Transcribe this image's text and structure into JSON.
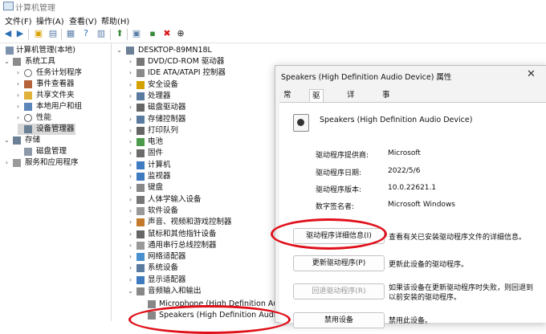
{
  "window": {
    "title": "计算机管理"
  },
  "menu": [
    "文件(F)",
    "操作(A)",
    "查看(V)",
    "帮助(H)"
  ],
  "toolbar": {
    "icons": [
      "back-arrow-icon",
      "forward-arrow-icon",
      "folder-up-icon",
      "console-tree-icon",
      "properties-icon",
      "help-icon",
      "show-pane-icon",
      "update-driver-icon",
      "enable-icon",
      "delete-icon",
      "download-icon"
    ]
  },
  "left_tree": [
    {
      "label": "计算机管理(本地)",
      "icon": "computer-mgmt-icon"
    },
    {
      "label": "系统工具",
      "icon": "tools-icon"
    },
    {
      "label": "任务计划程序",
      "icon": "clock-icon"
    },
    {
      "label": "事件查看器",
      "icon": "event-viewer-icon"
    },
    {
      "label": "共享文件夹",
      "icon": "shared-folder-icon"
    },
    {
      "label": "本地用户和组",
      "icon": "users-icon"
    },
    {
      "label": "性能",
      "icon": "performance-icon"
    },
    {
      "label": "设备管理器",
      "icon": "device-manager-icon"
    },
    {
      "label": "存储",
      "icon": "storage-icon"
    },
    {
      "label": "磁盘管理",
      "icon": "disk-icon"
    },
    {
      "label": "服务和应用程序",
      "icon": "services-icon"
    }
  ],
  "device_tree": {
    "root": "DESKTOP-89MN18L",
    "categories": [
      "DVD/CD-ROM 驱动器",
      "IDE ATA/ATAPI 控制器",
      "安全设备",
      "处理器",
      "磁盘驱动器",
      "存储控制器",
      "打印队列",
      "电池",
      "固件",
      "计算机",
      "监视器",
      "键盘",
      "人体学输入设备",
      "软件设备",
      "声音、视频和游戏控制器",
      "鼠标和其他指针设备",
      "通用串行总线控制器",
      "网络适配器",
      "系统设备",
      "显示适配器",
      "音频输入和输出"
    ],
    "audio_children": [
      "Microphone (High Definition Audio",
      "Speakers (High Definition Audio De"
    ]
  },
  "dialog": {
    "title": "Speakers (High Definition Audio Device) 属性",
    "tabs": [
      "常规",
      "驱动程序",
      "详细信息",
      "事件"
    ],
    "device_name": "Speakers (High Definition Audio Device)",
    "props": [
      {
        "label": "驱动程序提供商:",
        "value": "Microsoft"
      },
      {
        "label": "驱动程序日期:",
        "value": "2022/5/6"
      },
      {
        "label": "驱动程序版本:",
        "value": "10.0.22621.1"
      },
      {
        "label": "数字签名者:",
        "value": "Microsoft Windows"
      }
    ],
    "buttons": [
      {
        "label": "驱动程序详细信息(I)",
        "desc": [
          "查看有关已安装驱动程序文件的详细信息。"
        ],
        "disabled": false
      },
      {
        "label": "更新驱动程序(P)",
        "desc": [
          "更新此设备的驱动程序。"
        ],
        "disabled": false
      },
      {
        "label": "回退驱动程序(R)",
        "desc": [
          "如果该设备在更新驱动程序时失败，则回退到",
          "以前安装的驱动程序。"
        ],
        "disabled": true
      },
      {
        "label": "禁用设备",
        "desc": [
          "禁用此设备。"
        ],
        "disabled": false
      }
    ]
  }
}
